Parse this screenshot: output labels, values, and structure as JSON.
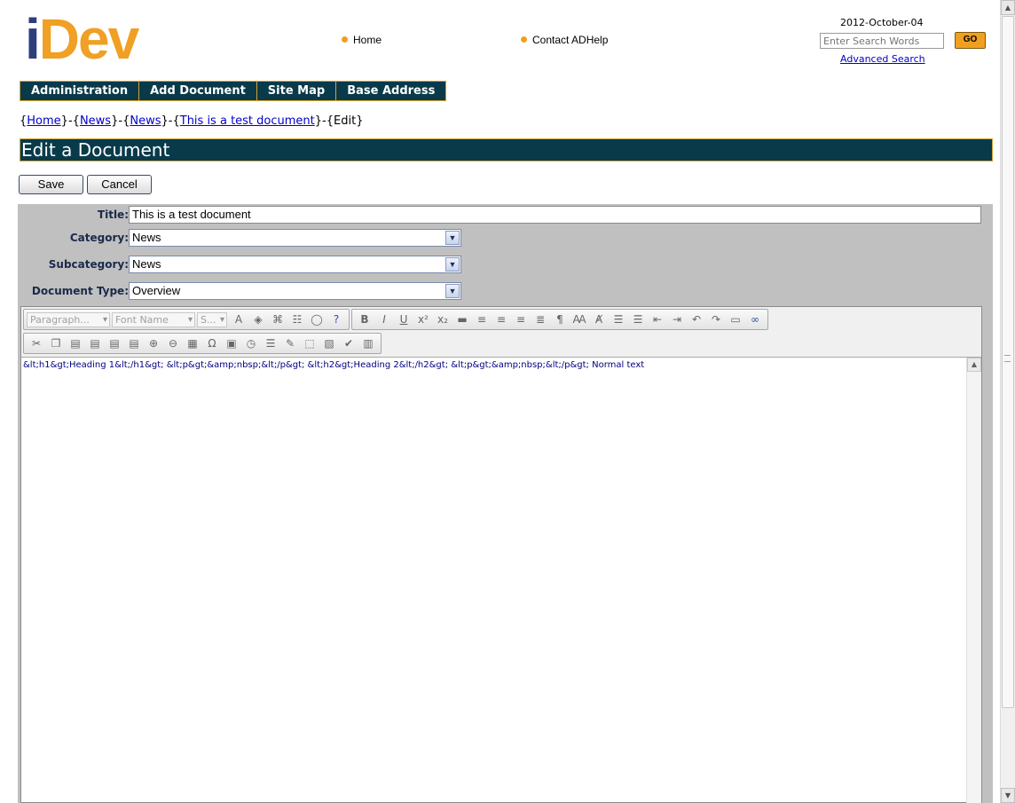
{
  "logo": {
    "part1": "i",
    "part2": "Dev"
  },
  "toplinks": {
    "home": "Home",
    "contact": "Contact ADHelp"
  },
  "date": "2012-October-04",
  "search": {
    "placeholder": "Enter Search Words",
    "go_label": "GO",
    "advanced_label": "Advanced Search"
  },
  "nav": {
    "items": [
      {
        "label": "Administration"
      },
      {
        "label": "Add Document"
      },
      {
        "label": "Site Map"
      },
      {
        "label": "Base Address"
      }
    ]
  },
  "breadcrumb": {
    "open": "{",
    "close": "}",
    "sep": "-",
    "items": [
      "Home",
      "News",
      "News",
      "This is a test document"
    ],
    "current": "Edit"
  },
  "page_title": "Edit a Document",
  "buttons": {
    "save": "Save",
    "cancel": "Cancel"
  },
  "form": {
    "title_label": "Title:",
    "title_value": "This is a test document",
    "category_label": "Category:",
    "category_value": "News",
    "subcategory_label": "Subcategory:",
    "subcategory_value": "News",
    "doctype_label": "Document Type:",
    "doctype_value": "Overview"
  },
  "editor": {
    "paragraph_dropdown": "Paragraph...",
    "fontname_dropdown": "Font Name",
    "size_dropdown": "S...",
    "content": "&lt;h1&gt;Heading 1&lt;/h1&gt; &lt;p&gt;&amp;nbsp;&lt;/p&gt; &lt;h2&gt;Heading 2&lt;/h2&gt; &lt;p&gt;&amp;nbsp;&lt;/p&gt; Normal text"
  }
}
